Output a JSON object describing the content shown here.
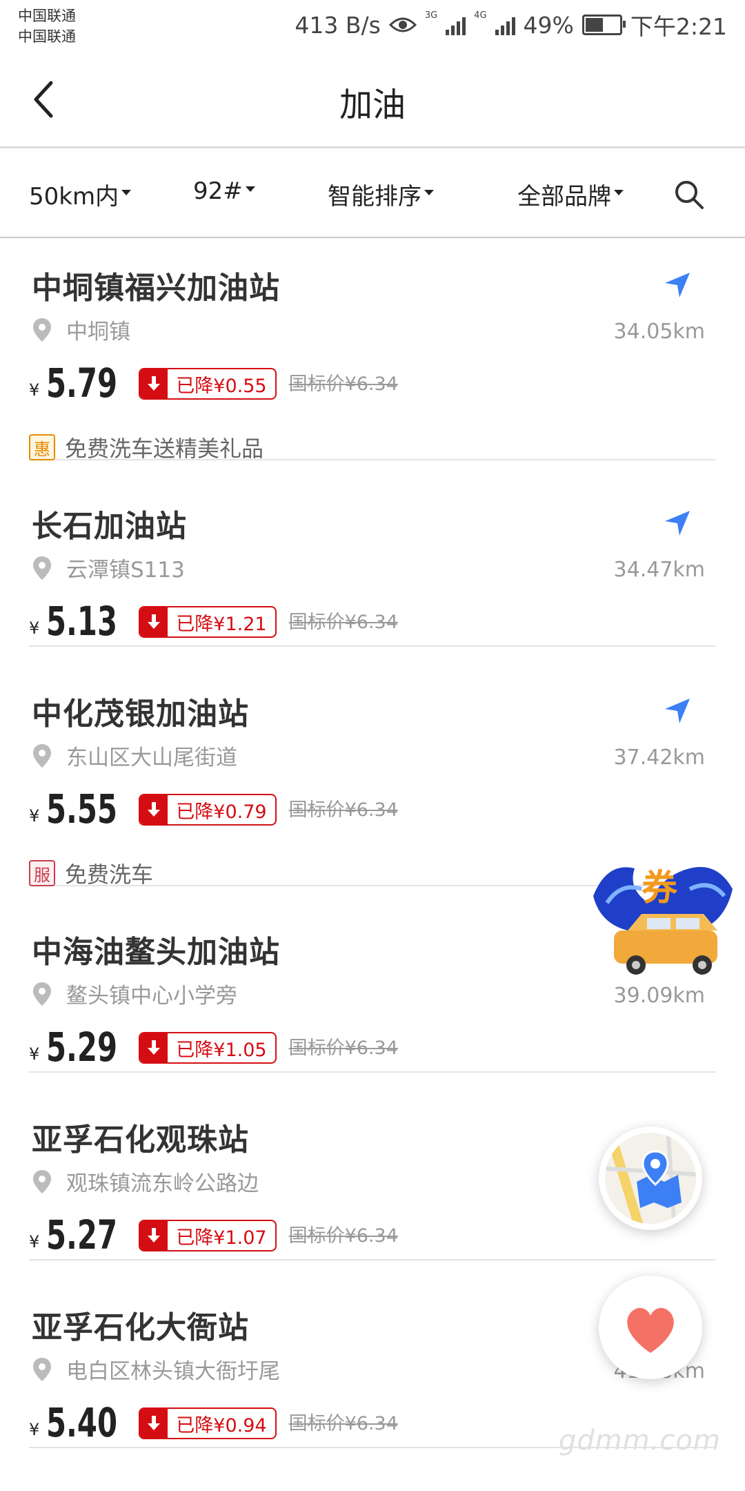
{
  "status_bar": {
    "carrier_1": "中国联通",
    "carrier_2": "中国联通",
    "speed": "413 B/s",
    "net_1": "3G",
    "net_2": "4G",
    "battery": "49%",
    "battery_level": 0.49,
    "time": "下午2:21"
  },
  "header": {
    "title": "加油",
    "back_icon": "chevron-left-icon"
  },
  "filters": {
    "range": "50km内",
    "fuel": "92#",
    "sort": "智能排序",
    "brand": "全部品牌",
    "search_icon": "search-icon"
  },
  "stations": [
    {
      "name": "中垌镇福兴加油站",
      "address": "中垌镇",
      "distance": "34.05km",
      "price": "5.79",
      "drop": "已降¥0.55",
      "standard": "国标价¥6.34",
      "promo_tag": "惠",
      "promo": "免费洗车送精美礼品"
    },
    {
      "name": "长石加油站",
      "address": "云潭镇S113",
      "distance": "34.47km",
      "price": "5.13",
      "drop": "已降¥1.21",
      "standard": "国标价¥6.34"
    },
    {
      "name": "中化茂银加油站",
      "address": "东山区大山尾街道",
      "distance": "37.42km",
      "price": "5.55",
      "drop": "已降¥0.79",
      "standard": "国标价¥6.34",
      "promo_tag": "服",
      "promo": "免费洗车"
    },
    {
      "name": "中海油鳌头加油站",
      "address": "鳌头镇中心小学旁",
      "distance": "39.09km",
      "price": "5.29",
      "drop": "已降¥1.05",
      "standard": "国标价¥6.34"
    },
    {
      "name": "亚孚石化观珠站",
      "address": "观珠镇流东岭公路边",
      "distance": "",
      "price": "5.27",
      "drop": "已降¥1.07",
      "standard": "国标价¥6.34"
    },
    {
      "name": "亚孚石化大衙站",
      "address": "电白区林头镇大衙圩尾",
      "distance": "41.38km",
      "price": "5.40",
      "drop": "已降¥0.94",
      "standard": "国标价¥6.34"
    }
  ],
  "currency_symbol": "¥",
  "floating": {
    "coupon_label": "券",
    "watermark": "gdmm.com"
  },
  "colors": {
    "accent_red": "#d40d12",
    "nav_blue": "#3d7ff5",
    "promo_orange": "#e58a00"
  }
}
